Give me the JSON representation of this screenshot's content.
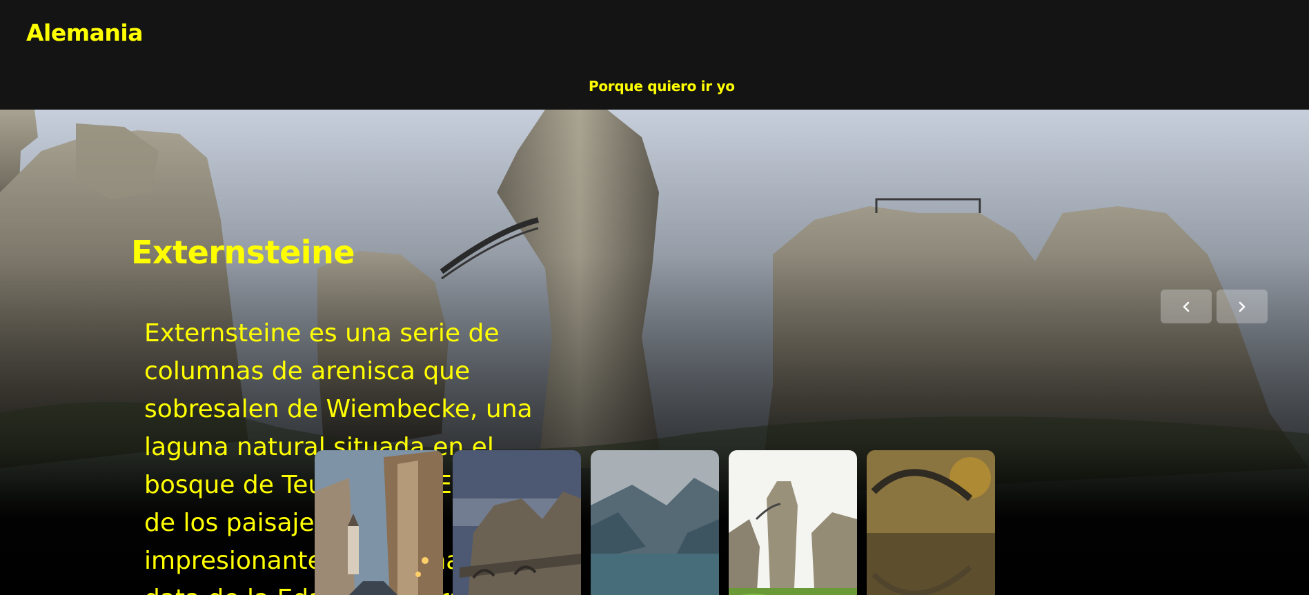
{
  "header": {
    "brand": "Alemania",
    "nav_link": "Porque quiero ir yo"
  },
  "hero": {
    "title": "Externsteine",
    "description": "Externsteine es una serie de columnas de arenisca que sobresalen de Wiembecke, una laguna natural situada en el bosque de Teutoburgo. Es uno de los paisajes más impresionantes de Alemania y data de la Edad de Piedra."
  },
  "carousel": {
    "prev_icon": "chevron-left-icon",
    "next_icon": "chevron-right-icon",
    "thumbnails": [
      {
        "name": "thumbnail-old-town-street"
      },
      {
        "name": "thumbnail-bastei-bridge"
      },
      {
        "name": "thumbnail-lake-valley"
      },
      {
        "name": "thumbnail-externsteine"
      },
      {
        "name": "thumbnail-rakotz-bridge"
      }
    ]
  },
  "colors": {
    "accent": "#ffff00",
    "header_bg": "#141414"
  }
}
